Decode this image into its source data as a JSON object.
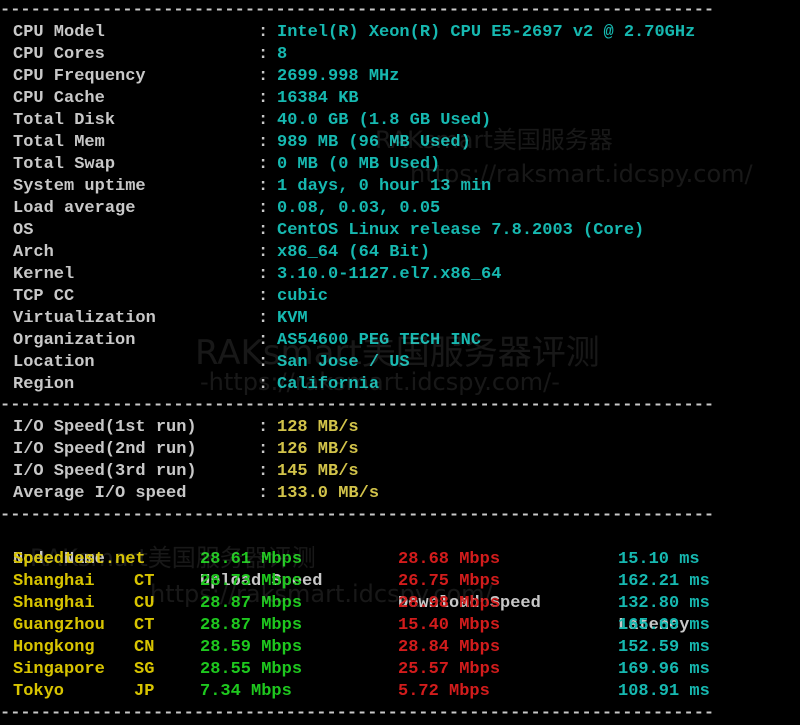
{
  "system_info": [
    {
      "label": "CPU Model",
      "value": "Intel(R) Xeon(R) CPU E5-2697 v2 @ 2.70GHz"
    },
    {
      "label": "CPU Cores",
      "value": "8"
    },
    {
      "label": "CPU Frequency",
      "value": "2699.998 MHz"
    },
    {
      "label": "CPU Cache",
      "value": "16384 KB"
    },
    {
      "label": "Total Disk",
      "value": "40.0 GB (1.8 GB Used)"
    },
    {
      "label": "Total Mem",
      "value": "989 MB (96 MB Used)"
    },
    {
      "label": "Total Swap",
      "value": "0 MB (0 MB Used)"
    },
    {
      "label": "System uptime",
      "value": "1 days, 0 hour 13 min"
    },
    {
      "label": "Load average",
      "value": "0.08, 0.03, 0.05"
    },
    {
      "label": "OS",
      "value": "CentOS Linux release 7.8.2003 (Core)"
    },
    {
      "label": "Arch",
      "value": "x86_64 (64 Bit)"
    },
    {
      "label": "Kernel",
      "value": "3.10.0-1127.el7.x86_64"
    },
    {
      "label": "TCP CC",
      "value": "cubic"
    },
    {
      "label": "Virtualization",
      "value": "KVM"
    },
    {
      "label": "Organization",
      "value": "AS54600 PEG TECH INC"
    },
    {
      "label": "Location",
      "value": "San Jose / US"
    },
    {
      "label": "Region",
      "value": "California"
    }
  ],
  "io_speed": [
    {
      "label": "I/O Speed(1st run)",
      "value": "128 MB/s"
    },
    {
      "label": "I/O Speed(2nd run)",
      "value": "126 MB/s"
    },
    {
      "label": "I/O Speed(3rd run)",
      "value": "145 MB/s"
    },
    {
      "label": "Average I/O speed",
      "value": "133.0 MB/s"
    }
  ],
  "speedtest": {
    "headers": {
      "node": "Node Name",
      "upload": "Upload Speed",
      "download": "Download Speed",
      "latency": "Latency"
    },
    "rows": [
      {
        "node": "Speedtest.net",
        "loc": "",
        "upload": "28.61 Mbps",
        "download": "28.68 Mbps",
        "latency": "15.10 ms"
      },
      {
        "node": "Shanghai",
        "loc": "CT",
        "upload": "28.73 Mbps",
        "download": "26.75 Mbps",
        "latency": "162.21 ms"
      },
      {
        "node": "Shanghai",
        "loc": "CU",
        "upload": "28.87 Mbps",
        "download": "28.98 Mbps",
        "latency": "132.80 ms"
      },
      {
        "node": "Guangzhou",
        "loc": "CT",
        "upload": "28.87 Mbps",
        "download": "15.40 Mbps",
        "latency": "165.69 ms"
      },
      {
        "node": "Hongkong",
        "loc": "CN",
        "upload": "28.59 Mbps",
        "download": "28.84 Mbps",
        "latency": "152.59 ms"
      },
      {
        "node": "Singapore",
        "loc": "SG",
        "upload": "28.55 Mbps",
        "download": "25.57 Mbps",
        "latency": "169.96 ms"
      },
      {
        "node": "Tokyo",
        "loc": "JP",
        "upload": "7.34 Mbps",
        "download": "5.72 Mbps",
        "latency": "108.91 ms"
      }
    ]
  },
  "separator": "----------------------------------------------------------------------",
  "colon": ":",
  "watermarks": [
    "RAKsmart美国服务器",
    "https://raksmart.idcspy.com/",
    "RAKsmart美国服务器评测",
    "-https://raksmart.idcspy.com/-",
    "RAKsmart美国服务器评测",
    "https://raksmart.idcspy.com/"
  ],
  "colors": {
    "background": "#000000",
    "label": "#c8c8c8",
    "value_cyan": "#16b8b0",
    "value_yellow": "#d2c34a",
    "node_yellow": "#d8c400",
    "upload_green": "#1ec81e",
    "download_red": "#d21c1c",
    "latency_cyan": "#16b8b0"
  }
}
